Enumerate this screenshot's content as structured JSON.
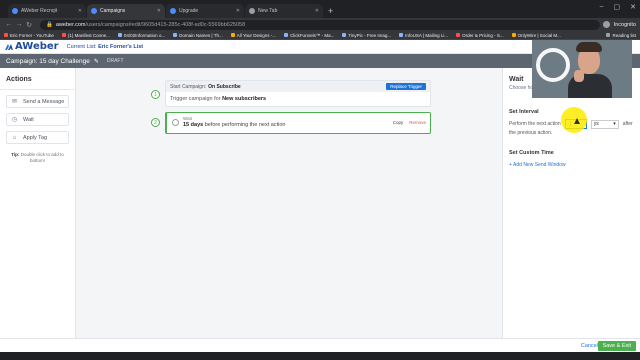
{
  "browser": {
    "tabs": [
      {
        "title": "AWeber Recnqit",
        "active": false
      },
      {
        "title": "Campaigns",
        "active": true
      },
      {
        "title": "Upgrade",
        "active": false
      },
      {
        "title": "New Tab",
        "active": false
      }
    ],
    "new_tab": "+",
    "url_host": "aweber.com",
    "url_path": "/users/campaigns#edit/9605d415-285c-408f-ad0c-5569bb625058",
    "profile_label": "Incognito",
    "bookmarks": [
      "Eric Forner - YouTube",
      "(1) Manifest Conne...",
      "04/02Information o...",
      "Domain Names | Th...",
      "All Your Designs -...",
      "ClickFunnels™ - Ma...",
      "TinyPic - Free Imag...",
      "InfoUSA | Mailing Li...",
      "Order & Pricing - S...",
      "OnlyWire | Social M...",
      "Reading list"
    ]
  },
  "app": {
    "logo": "AWeber",
    "current_list_label": "Current List:",
    "current_list_value": "Eric Forner's List",
    "campaign_title": "Campaign: 15 day Challenge",
    "campaign_status": "DRAFT"
  },
  "sidebar": {
    "heading": "Actions",
    "items": [
      "Send a Message",
      "Wait",
      "Apply Tag"
    ],
    "tip_label": "Tip:",
    "tip_text": "Double click to add to bottom!"
  },
  "canvas": {
    "step1_number": "1",
    "step1_title_prefix": "Start Campaign:",
    "step1_title": "On Subscribe",
    "step1_replace": "Replace Trigger",
    "step1_body_prefix": "Trigger campaign for",
    "step1_body": "New subscribers",
    "step2_number": "2",
    "step2_kind": "Wait",
    "step2_duration": "15 days",
    "step2_suffix": "before performing the next action",
    "step2_copy": "Copy",
    "step2_remove": "Remove"
  },
  "panel": {
    "title": "Wait",
    "subtitle": "Choose ho",
    "set_interval": "Set Interval",
    "interval_prefix": "Perform the next action",
    "interval_value": "1",
    "interval_unit": "ys",
    "interval_after": "after",
    "interval_suffix": "the previous action.",
    "custom_time": "Set Custom Time",
    "add_window": "+ Add New Send Window"
  },
  "footer": {
    "cancel": "Cancel",
    "save": "Save & Exit"
  },
  "colors": {
    "brand": "#1e4b9b",
    "accent": "#1e73d9",
    "success": "#4caf50",
    "danger": "#d9534f",
    "highlight": "#ffeb00"
  }
}
